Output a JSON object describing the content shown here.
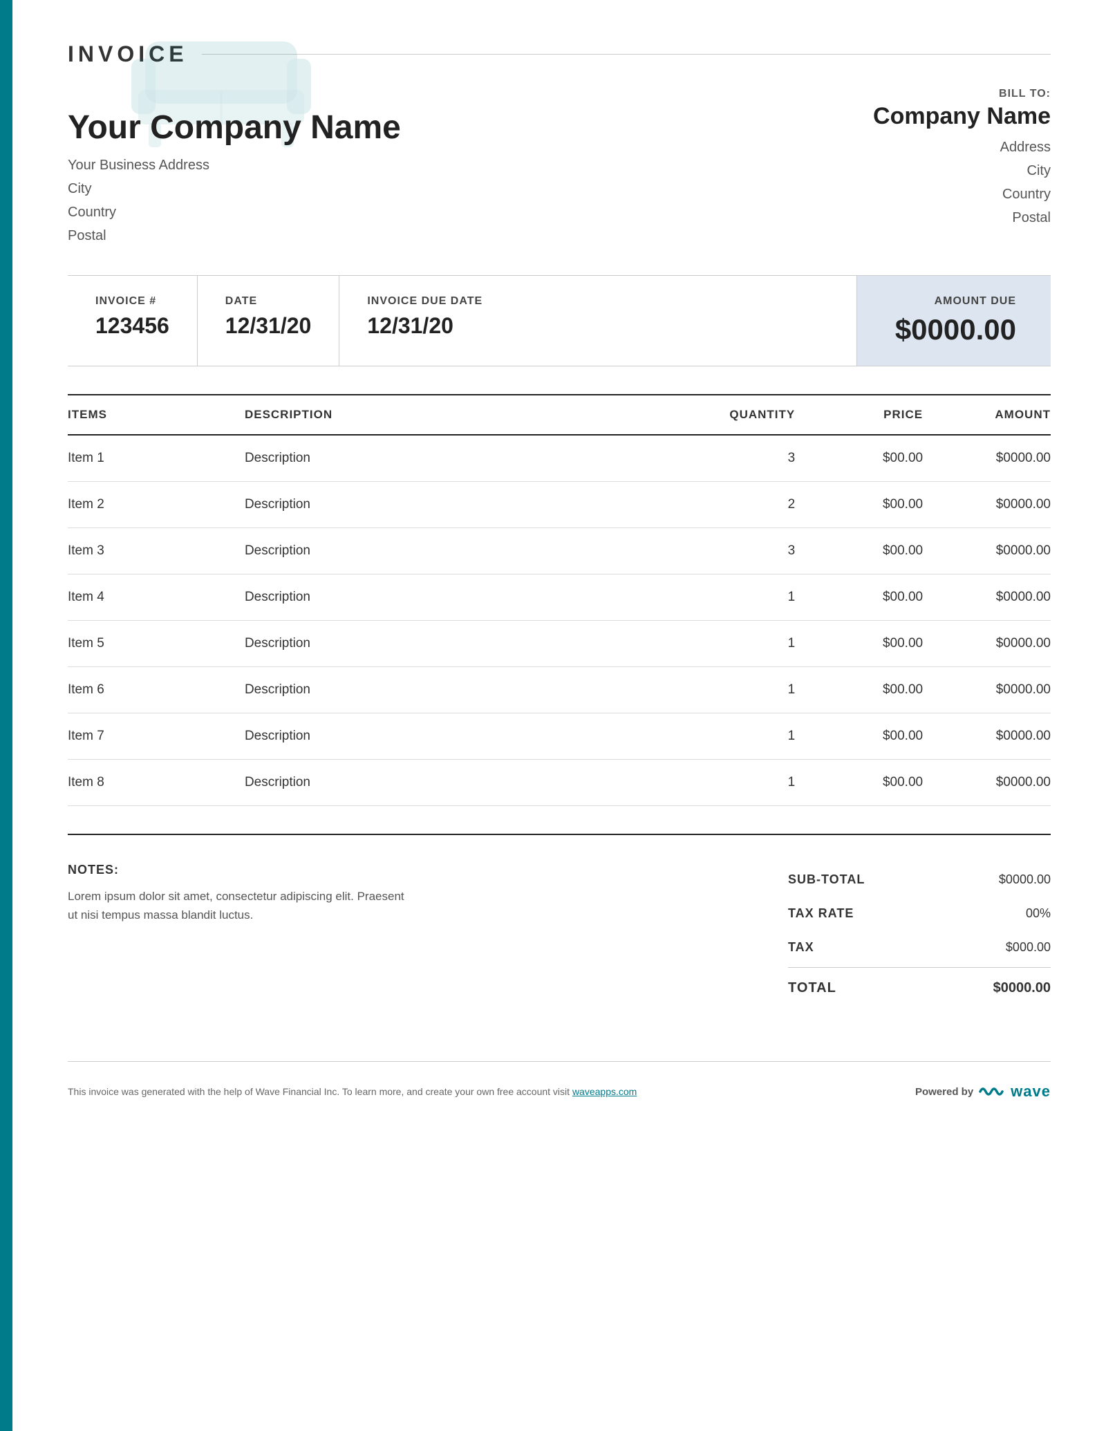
{
  "header": {
    "invoice_title": "INVOICE",
    "company_name": "Your Company Name",
    "business_address": "Your Business Address",
    "city": "City",
    "country": "Country",
    "postal": "Postal"
  },
  "bill_to": {
    "label": "BILL TO:",
    "company_name": "Company Name",
    "address": "Address",
    "city": "City",
    "country": "Country",
    "postal": "Postal"
  },
  "meta": {
    "invoice_number_label": "INVOICE #",
    "invoice_number": "123456",
    "date_label": "DATE",
    "date": "12/31/20",
    "due_date_label": "INVOICE DUE DATE",
    "due_date": "12/31/20",
    "amount_due_label": "AMOUNT DUE",
    "amount_due": "$0000.00"
  },
  "items_table": {
    "col_items": "ITEMS",
    "col_description": "DESCRIPTION",
    "col_quantity": "QUANTITY",
    "col_price": "PRICE",
    "col_amount": "AMOUNT",
    "rows": [
      {
        "item": "Item 1",
        "description": "Description",
        "quantity": "3",
        "price": "$00.00",
        "amount": "$0000.00"
      },
      {
        "item": "Item 2",
        "description": "Description",
        "quantity": "2",
        "price": "$00.00",
        "amount": "$0000.00"
      },
      {
        "item": "Item 3",
        "description": "Description",
        "quantity": "3",
        "price": "$00.00",
        "amount": "$0000.00"
      },
      {
        "item": "Item 4",
        "description": "Description",
        "quantity": "1",
        "price": "$00.00",
        "amount": "$0000.00"
      },
      {
        "item": "Item 5",
        "description": "Description",
        "quantity": "1",
        "price": "$00.00",
        "amount": "$0000.00"
      },
      {
        "item": "Item 6",
        "description": "Description",
        "quantity": "1",
        "price": "$00.00",
        "amount": "$0000.00"
      },
      {
        "item": "Item 7",
        "description": "Description",
        "quantity": "1",
        "price": "$00.00",
        "amount": "$0000.00"
      },
      {
        "item": "Item 8",
        "description": "Description",
        "quantity": "1",
        "price": "$00.00",
        "amount": "$0000.00"
      }
    ]
  },
  "notes": {
    "label": "NOTES:",
    "text": "Lorem ipsum dolor sit amet, consectetur adipiscing elit. Praesent ut nisi tempus massa blandit luctus."
  },
  "totals": {
    "subtotal_label": "SUB-TOTAL",
    "subtotal_value": "$0000.00",
    "tax_rate_label": "TAX RATE",
    "tax_rate_value": "00%",
    "tax_label": "TAX",
    "tax_value": "$000.00",
    "total_label": "TOTAL",
    "total_value": "$0000.00"
  },
  "footer": {
    "text": "This invoice was generated with the help of Wave Financial Inc. To learn more, and create your own free account visit",
    "link_text": "waveapps.com",
    "powered_by": "Powered by",
    "wave_label": "wave"
  },
  "colors": {
    "accent": "#007b8a",
    "amount_due_bg": "#dde6f0"
  }
}
